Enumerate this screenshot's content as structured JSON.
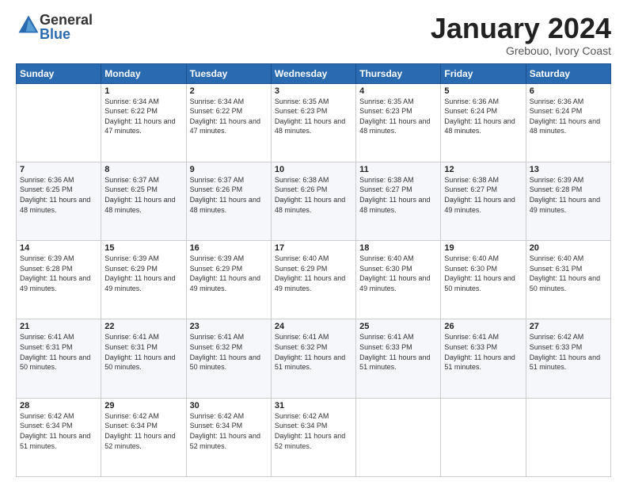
{
  "header": {
    "logo": {
      "general": "General",
      "blue": "Blue"
    },
    "title": "January 2024",
    "subtitle": "Grebouo, Ivory Coast"
  },
  "weekdays": [
    "Sunday",
    "Monday",
    "Tuesday",
    "Wednesday",
    "Thursday",
    "Friday",
    "Saturday"
  ],
  "weeks": [
    [
      {
        "day": "",
        "sunrise": "",
        "sunset": "",
        "daylight": ""
      },
      {
        "day": "1",
        "sunrise": "Sunrise: 6:34 AM",
        "sunset": "Sunset: 6:22 PM",
        "daylight": "Daylight: 11 hours and 47 minutes."
      },
      {
        "day": "2",
        "sunrise": "Sunrise: 6:34 AM",
        "sunset": "Sunset: 6:22 PM",
        "daylight": "Daylight: 11 hours and 47 minutes."
      },
      {
        "day": "3",
        "sunrise": "Sunrise: 6:35 AM",
        "sunset": "Sunset: 6:23 PM",
        "daylight": "Daylight: 11 hours and 48 minutes."
      },
      {
        "day": "4",
        "sunrise": "Sunrise: 6:35 AM",
        "sunset": "Sunset: 6:23 PM",
        "daylight": "Daylight: 11 hours and 48 minutes."
      },
      {
        "day": "5",
        "sunrise": "Sunrise: 6:36 AM",
        "sunset": "Sunset: 6:24 PM",
        "daylight": "Daylight: 11 hours and 48 minutes."
      },
      {
        "day": "6",
        "sunrise": "Sunrise: 6:36 AM",
        "sunset": "Sunset: 6:24 PM",
        "daylight": "Daylight: 11 hours and 48 minutes."
      }
    ],
    [
      {
        "day": "7",
        "sunrise": "Sunrise: 6:36 AM",
        "sunset": "Sunset: 6:25 PM",
        "daylight": "Daylight: 11 hours and 48 minutes."
      },
      {
        "day": "8",
        "sunrise": "Sunrise: 6:37 AM",
        "sunset": "Sunset: 6:25 PM",
        "daylight": "Daylight: 11 hours and 48 minutes."
      },
      {
        "day": "9",
        "sunrise": "Sunrise: 6:37 AM",
        "sunset": "Sunset: 6:26 PM",
        "daylight": "Daylight: 11 hours and 48 minutes."
      },
      {
        "day": "10",
        "sunrise": "Sunrise: 6:38 AM",
        "sunset": "Sunset: 6:26 PM",
        "daylight": "Daylight: 11 hours and 48 minutes."
      },
      {
        "day": "11",
        "sunrise": "Sunrise: 6:38 AM",
        "sunset": "Sunset: 6:27 PM",
        "daylight": "Daylight: 11 hours and 48 minutes."
      },
      {
        "day": "12",
        "sunrise": "Sunrise: 6:38 AM",
        "sunset": "Sunset: 6:27 PM",
        "daylight": "Daylight: 11 hours and 49 minutes."
      },
      {
        "day": "13",
        "sunrise": "Sunrise: 6:39 AM",
        "sunset": "Sunset: 6:28 PM",
        "daylight": "Daylight: 11 hours and 49 minutes."
      }
    ],
    [
      {
        "day": "14",
        "sunrise": "Sunrise: 6:39 AM",
        "sunset": "Sunset: 6:28 PM",
        "daylight": "Daylight: 11 hours and 49 minutes."
      },
      {
        "day": "15",
        "sunrise": "Sunrise: 6:39 AM",
        "sunset": "Sunset: 6:29 PM",
        "daylight": "Daylight: 11 hours and 49 minutes."
      },
      {
        "day": "16",
        "sunrise": "Sunrise: 6:39 AM",
        "sunset": "Sunset: 6:29 PM",
        "daylight": "Daylight: 11 hours and 49 minutes."
      },
      {
        "day": "17",
        "sunrise": "Sunrise: 6:40 AM",
        "sunset": "Sunset: 6:29 PM",
        "daylight": "Daylight: 11 hours and 49 minutes."
      },
      {
        "day": "18",
        "sunrise": "Sunrise: 6:40 AM",
        "sunset": "Sunset: 6:30 PM",
        "daylight": "Daylight: 11 hours and 49 minutes."
      },
      {
        "day": "19",
        "sunrise": "Sunrise: 6:40 AM",
        "sunset": "Sunset: 6:30 PM",
        "daylight": "Daylight: 11 hours and 50 minutes."
      },
      {
        "day": "20",
        "sunrise": "Sunrise: 6:40 AM",
        "sunset": "Sunset: 6:31 PM",
        "daylight": "Daylight: 11 hours and 50 minutes."
      }
    ],
    [
      {
        "day": "21",
        "sunrise": "Sunrise: 6:41 AM",
        "sunset": "Sunset: 6:31 PM",
        "daylight": "Daylight: 11 hours and 50 minutes."
      },
      {
        "day": "22",
        "sunrise": "Sunrise: 6:41 AM",
        "sunset": "Sunset: 6:31 PM",
        "daylight": "Daylight: 11 hours and 50 minutes."
      },
      {
        "day": "23",
        "sunrise": "Sunrise: 6:41 AM",
        "sunset": "Sunset: 6:32 PM",
        "daylight": "Daylight: 11 hours and 50 minutes."
      },
      {
        "day": "24",
        "sunrise": "Sunrise: 6:41 AM",
        "sunset": "Sunset: 6:32 PM",
        "daylight": "Daylight: 11 hours and 51 minutes."
      },
      {
        "day": "25",
        "sunrise": "Sunrise: 6:41 AM",
        "sunset": "Sunset: 6:33 PM",
        "daylight": "Daylight: 11 hours and 51 minutes."
      },
      {
        "day": "26",
        "sunrise": "Sunrise: 6:41 AM",
        "sunset": "Sunset: 6:33 PM",
        "daylight": "Daylight: 11 hours and 51 minutes."
      },
      {
        "day": "27",
        "sunrise": "Sunrise: 6:42 AM",
        "sunset": "Sunset: 6:33 PM",
        "daylight": "Daylight: 11 hours and 51 minutes."
      }
    ],
    [
      {
        "day": "28",
        "sunrise": "Sunrise: 6:42 AM",
        "sunset": "Sunset: 6:34 PM",
        "daylight": "Daylight: 11 hours and 51 minutes."
      },
      {
        "day": "29",
        "sunrise": "Sunrise: 6:42 AM",
        "sunset": "Sunset: 6:34 PM",
        "daylight": "Daylight: 11 hours and 52 minutes."
      },
      {
        "day": "30",
        "sunrise": "Sunrise: 6:42 AM",
        "sunset": "Sunset: 6:34 PM",
        "daylight": "Daylight: 11 hours and 52 minutes."
      },
      {
        "day": "31",
        "sunrise": "Sunrise: 6:42 AM",
        "sunset": "Sunset: 6:34 PM",
        "daylight": "Daylight: 11 hours and 52 minutes."
      },
      {
        "day": "",
        "sunrise": "",
        "sunset": "",
        "daylight": ""
      },
      {
        "day": "",
        "sunrise": "",
        "sunset": "",
        "daylight": ""
      },
      {
        "day": "",
        "sunrise": "",
        "sunset": "",
        "daylight": ""
      }
    ]
  ]
}
